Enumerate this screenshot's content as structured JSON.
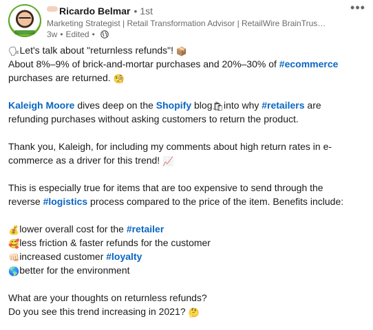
{
  "author": {
    "name": "Ricardo Belmar",
    "degree": "1st",
    "headline": "Marketing Strategist | Retail Transformation Advisor | RetailWire BrainTrus…",
    "time": "3w",
    "edited": "Edited"
  },
  "post": {
    "line1": {
      "emoji": "🗣",
      "text": "Let's talk about \"returnless refunds\"! ",
      "emoji_end": "📦"
    },
    "line2": {
      "pre": "About 8%–9% of brick-and-mortar purchases and 20%–30% of ",
      "tag": "#ecommerce"
    },
    "line3": {
      "text": "purchases are returned. ",
      "emoji": "🧐"
    },
    "line4": {
      "mention": "Kaleigh Moore",
      "mid1": " dives deep on the ",
      "mention2": "Shopify",
      "mid2": " blog",
      "emoji": "🛍",
      "mid3": "into why ",
      "tag": "#retailers",
      "post": " are"
    },
    "line5": "refunding purchases without asking customers to return the product.",
    "line6": "Thank you, Kaleigh, for including my comments about high return rates in e-",
    "line7": {
      "text": "commerce as a driver for this trend! ",
      "emoji": "📈"
    },
    "line8": "This is especially true for items that are too expensive to send through the",
    "line9": {
      "pre": "reverse ",
      "tag": "#logistics",
      "post": " process compared to the price of the item. Benefits include:"
    },
    "b1": {
      "emoji": "💰",
      "text": "lower overall cost for the ",
      "tag": "#retailer"
    },
    "b2": {
      "emoji": "🥰",
      "text": "less friction & faster refunds for the customer"
    },
    "b3": {
      "emoji": "👊🏻",
      "text": "increased customer ",
      "tag": "#loyalty"
    },
    "b4": {
      "emoji": "🌎",
      "text": "better for the environment"
    },
    "q1": "What are your thoughts on returnless refunds?",
    "q2": {
      "text": "Do you see this trend increasing in 2021? ",
      "emoji": "🤔"
    }
  },
  "icons": {
    "globe": "globe-icon",
    "more": "more-options-icon"
  },
  "colors": {
    "link": "#0a66c2",
    "text": "#000000e6",
    "muted": "#00000099"
  }
}
